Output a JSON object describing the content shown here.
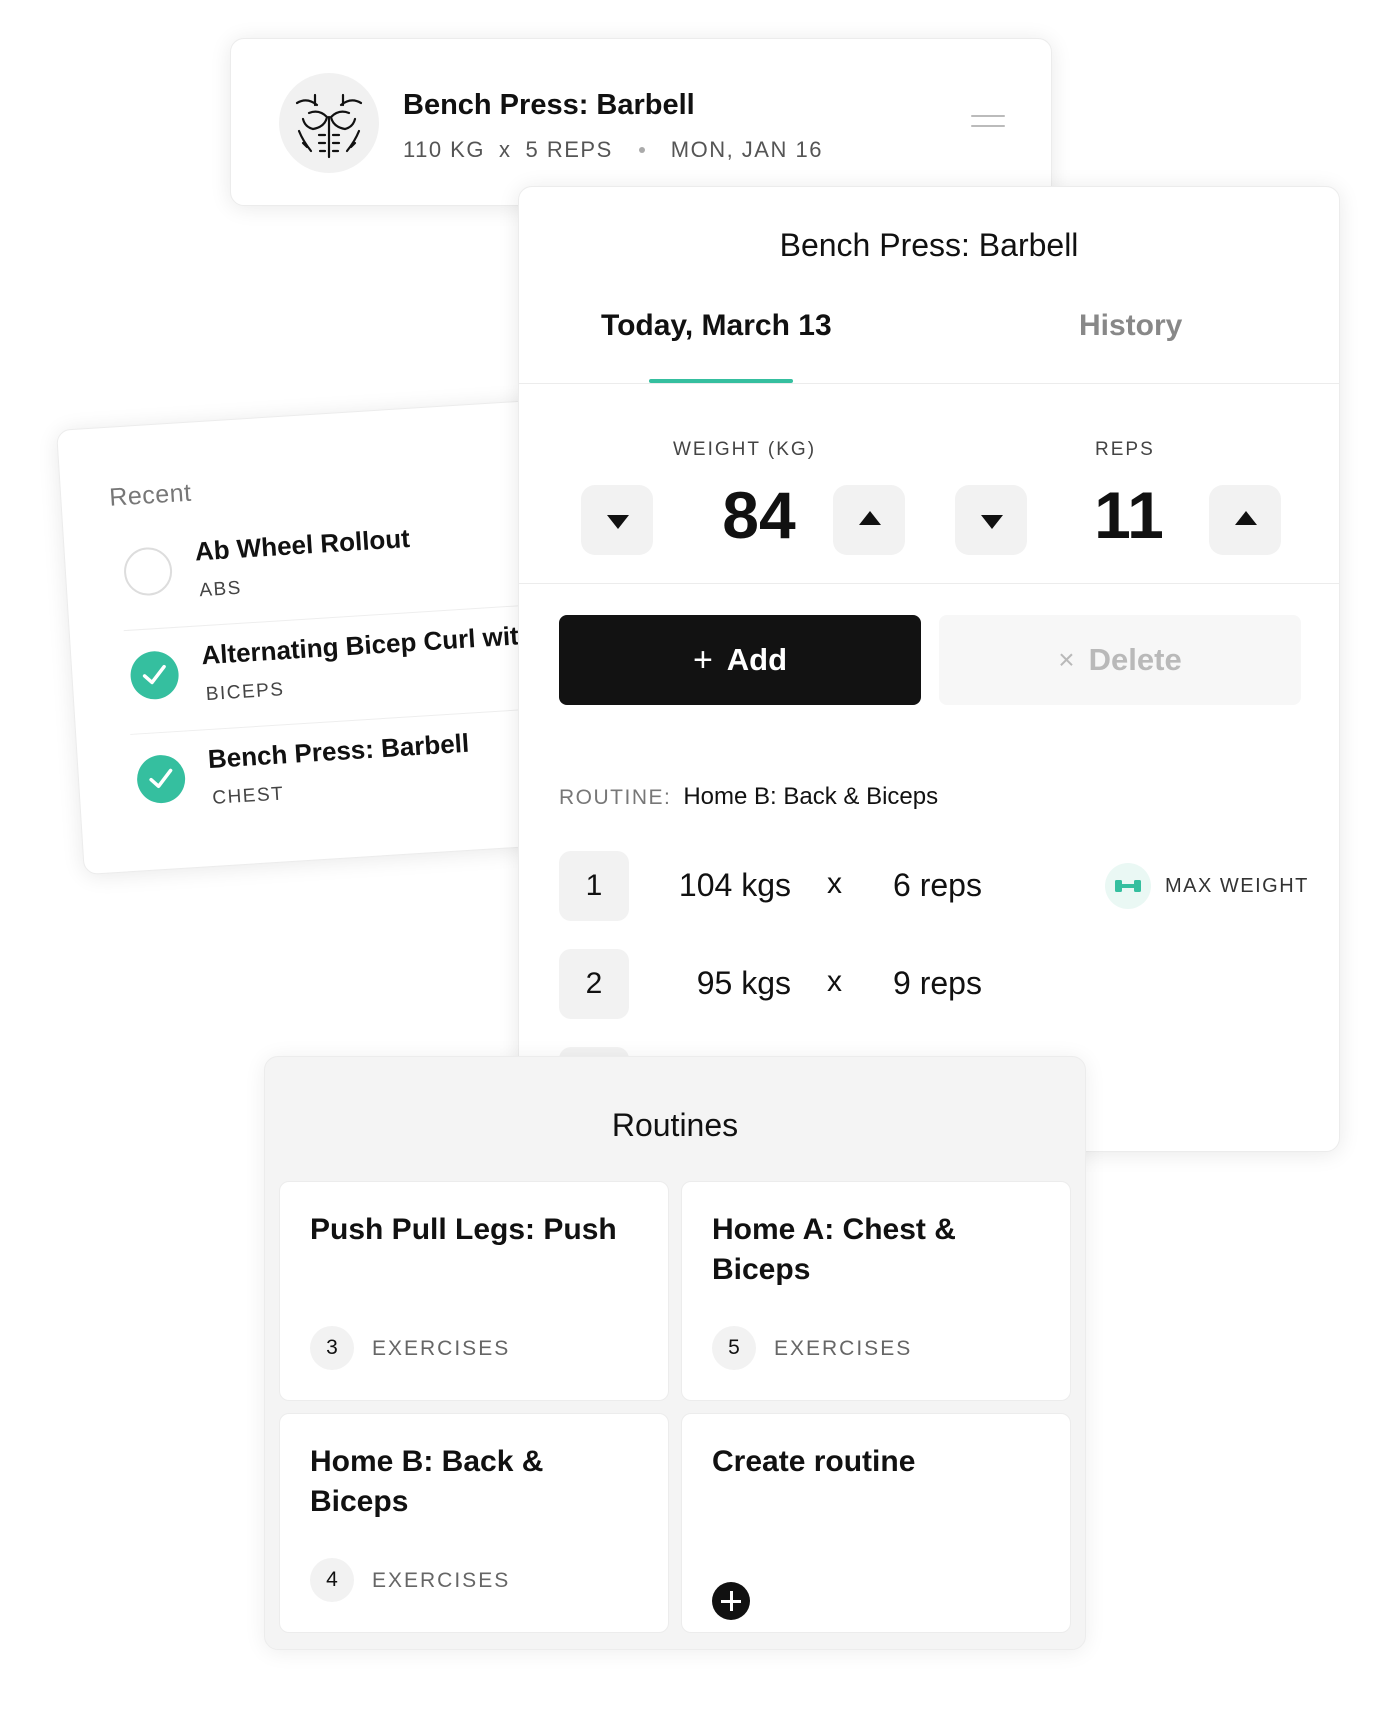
{
  "top_card": {
    "title": "Bench Press: Barbell",
    "weight": "110 KG",
    "times": "x",
    "reps": "5 REPS",
    "date": "MON, JAN 16",
    "avatar_icon": "chest-muscle-icon",
    "menu_icon": "hamburger-menu-icon"
  },
  "recent": {
    "heading": "Recent",
    "items": [
      {
        "name": "Ab Wheel Rollout",
        "category": "ABS",
        "checked": false
      },
      {
        "name": "Alternating Bicep Curl wit",
        "category": "BICEPS",
        "checked": true
      },
      {
        "name": "Bench Press: Barbell",
        "category": "CHEST",
        "checked": true
      }
    ]
  },
  "detail": {
    "title": "Bench Press: Barbell",
    "tabs": [
      {
        "label": "Today, March 13",
        "active": true
      },
      {
        "label": "History",
        "active": false
      }
    ],
    "weight": {
      "label": "WEIGHT (KG)",
      "value": "84"
    },
    "reps": {
      "label": "REPS",
      "value": "11"
    },
    "add_label": "Add",
    "delete_label": "Delete",
    "routine_label": "ROUTINE:",
    "routine_value": "Home B: Back & Biceps",
    "sets": [
      {
        "num": "1",
        "kgs": "104 kgs",
        "x": "x",
        "reps": "6 reps",
        "badge": "MAX WEIGHT"
      },
      {
        "num": "2",
        "kgs": "95 kgs",
        "x": "x",
        "reps": "9 reps",
        "badge": ""
      }
    ],
    "accent": "#35bf9f"
  },
  "routines": {
    "heading": "Routines",
    "cards": [
      {
        "name": "Push Pull Legs: Push",
        "count": "3",
        "label": "EXERCISES"
      },
      {
        "name": "Home A: Chest & Biceps",
        "count": "5",
        "label": "EXERCISES"
      },
      {
        "name": "Home B: Back & Biceps",
        "count": "4",
        "label": "EXERCISES"
      },
      {
        "name": "Create routine",
        "icon": "plus-circle-icon"
      }
    ]
  }
}
